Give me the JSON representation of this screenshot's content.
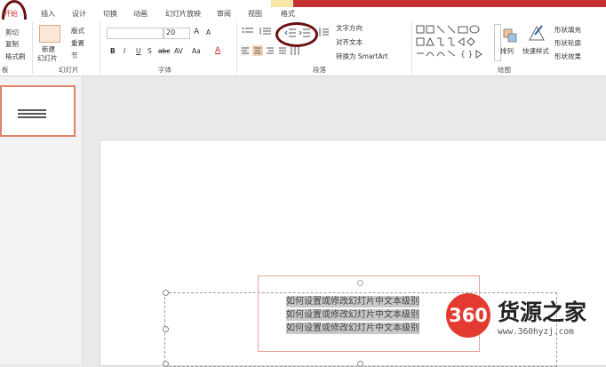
{
  "tabs": {
    "home": "开始",
    "insert": "插入",
    "design": "设计",
    "transitions": "切换",
    "animations": "动画",
    "slideshow": "幻灯片放映",
    "review": "审阅",
    "view": "视图",
    "format": "格式"
  },
  "clipboard": {
    "cut": "剪切",
    "copy": "复制",
    "format_painter": "格式刷",
    "label": "板"
  },
  "slides_group": {
    "new_slide_1": "新建",
    "new_slide_2": "幻灯片",
    "layout": "版式",
    "reset": "重置",
    "section": "节",
    "label": "幻灯片"
  },
  "font_group": {
    "font_size": "20",
    "grow_font": "A",
    "shrink_font": "A",
    "bold": "B",
    "italic": "I",
    "underline": "U",
    "shadow": "S",
    "strike": "abc",
    "spacing": "AV",
    "case": "Aa",
    "font_color": "A",
    "label": "字体"
  },
  "paragraph_group": {
    "text_direction": "文字方向",
    "align_text": "对齐文本",
    "convert_smartart": "转换为 SmartArt",
    "label": "段落"
  },
  "drawing_group": {
    "arrange": "排列",
    "quick_styles": "快速样式",
    "shape_fill": "形状填充",
    "shape_outline": "形状轮廓",
    "shape_effects": "形状效果",
    "label": "绘图"
  },
  "slide": {
    "lines": [
      "如何设置或修改幻灯片中文本级别",
      "如何设置或修改幻灯片中文本级别",
      "如何设置或修改幻灯片中文本级别"
    ]
  },
  "watermark": {
    "number": "360",
    "name": "货源之家",
    "url": "www.360hyzj.com"
  },
  "colors": {
    "accent_red": "#c62f2f",
    "highlight_circle": "#6b1111",
    "watermark_red": "#e33b2f"
  }
}
